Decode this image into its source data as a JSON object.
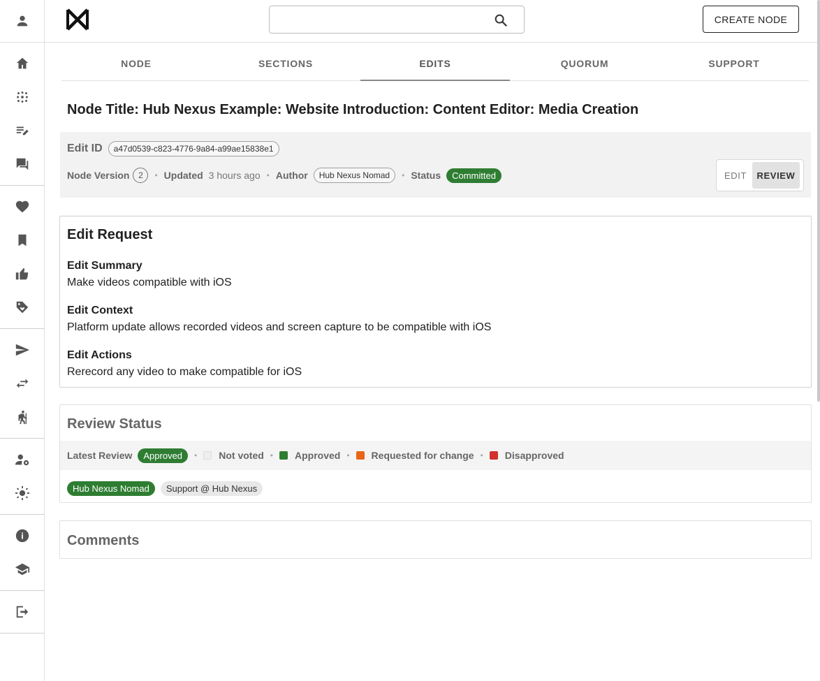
{
  "header": {
    "search_placeholder": "",
    "create_button": "CREATE NODE"
  },
  "sidebar": {
    "top_icon": "person-icon",
    "groups": [
      [
        "home-icon",
        "graph-dots-icon",
        "edit-list-icon",
        "forum-icon"
      ],
      [
        "heart-icon",
        "bookmark-icon",
        "thumb-up-icon",
        "tag-heart-icon"
      ],
      [
        "send-icon",
        "swap-icon",
        "hiking-icon"
      ],
      [
        "manage-accounts-icon",
        "brightness-icon"
      ],
      [
        "info-icon",
        "school-icon"
      ],
      [
        "logout-icon"
      ]
    ]
  },
  "tabs": [
    {
      "label": "NODE"
    },
    {
      "label": "SECTIONS"
    },
    {
      "label": "EDITS",
      "active": true
    },
    {
      "label": "QUORUM"
    },
    {
      "label": "SUPPORT"
    }
  ],
  "node_title": "Node Title: Hub Nexus Example: Website Introduction: Content Editor: Media Creation",
  "meta": {
    "edit_id_label": "Edit ID",
    "edit_id": "a47d0539-c823-4776-9a84-a99ae15838e1",
    "node_version_label": "Node Version",
    "node_version": "2",
    "updated_label": "Updated",
    "updated_value": "3 hours ago",
    "author_label": "Author",
    "author": "Hub Nexus Nomad",
    "status_label": "Status",
    "status": "Committed",
    "toggle_edit": "EDIT",
    "toggle_review": "REVIEW"
  },
  "edit_request": {
    "title": "Edit Request",
    "summary_label": "Edit Summary",
    "summary": "Make videos compatible with iOS",
    "context_label": "Edit Context",
    "context": "Platform update allows recorded videos and screen capture to be compatible with iOS",
    "actions_label": "Edit Actions",
    "actions": "Rerecord any video to make compatible for iOS"
  },
  "review_status": {
    "title": "Review Status",
    "latest_label": "Latest Review",
    "latest_value": "Approved",
    "legend": [
      {
        "label": "Not voted",
        "color": "#eeeeee"
      },
      {
        "label": "Approved",
        "color": "#2e7d32"
      },
      {
        "label": "Requested for change",
        "color": "#e8651a"
      },
      {
        "label": "Disapproved",
        "color": "#d32f2f"
      }
    ],
    "reviewers": [
      {
        "name": "Hub Nexus Nomad",
        "vote": "approved"
      },
      {
        "name": "Support @ Hub Nexus",
        "vote": "not-voted"
      }
    ]
  },
  "comments": {
    "title": "Comments"
  }
}
